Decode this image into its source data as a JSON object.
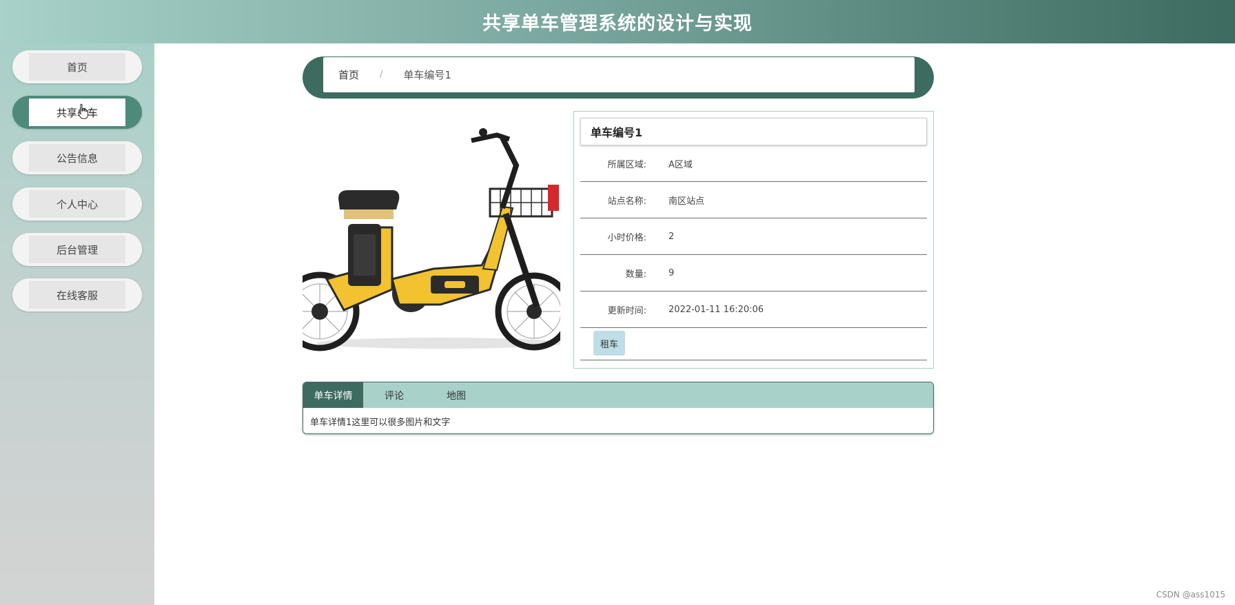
{
  "header": {
    "title": "共享单车管理系统的设计与实现"
  },
  "sidebar": {
    "items": [
      {
        "label": "首页"
      },
      {
        "label": "共享单车",
        "active": true
      },
      {
        "label": "公告信息"
      },
      {
        "label": "个人中心"
      },
      {
        "label": "后台管理"
      },
      {
        "label": "在线客服"
      }
    ]
  },
  "breadcrumb": {
    "home": "首页",
    "separator": "/",
    "current": "单车编号1"
  },
  "detail": {
    "title": "单车编号1",
    "rows": [
      {
        "label": "所属区域:",
        "value": "A区域"
      },
      {
        "label": "站点名称:",
        "value": "南区站点"
      },
      {
        "label": "小时价格:",
        "value": "2"
      },
      {
        "label": "数量:",
        "value": "9"
      },
      {
        "label": "更新时间:",
        "value": "2022-01-11 16:20:06"
      }
    ],
    "rent_button": "租车"
  },
  "tabs": {
    "items": [
      {
        "label": "单车详情",
        "active": true
      },
      {
        "label": "评论"
      },
      {
        "label": "地图"
      }
    ],
    "content": "单车详情1这里可以很多图片和文字"
  },
  "watermark": "CSDN @ass1015",
  "colors": {
    "accent": "#3d6b5f",
    "accent_light": "#a7d1c9",
    "bike_yellow": "#f2c230"
  }
}
